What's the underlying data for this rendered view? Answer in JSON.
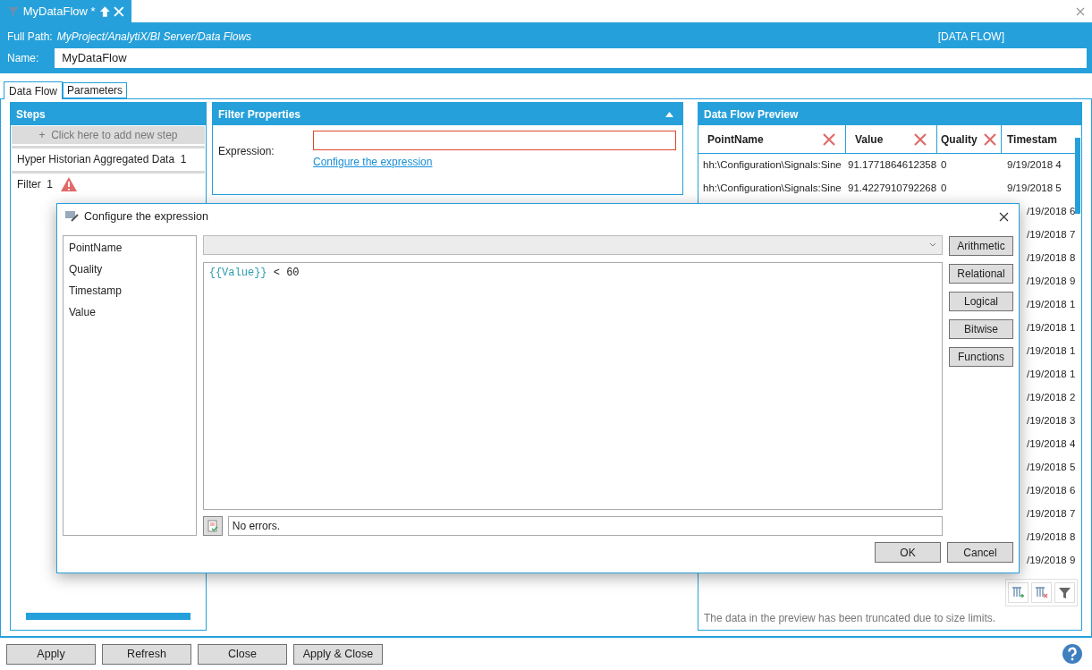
{
  "document_tab": {
    "title": "MyDataFlow *"
  },
  "header": {
    "full_path_label": "Full Path:",
    "full_path": "MyProject/AnalytiX/BI Server/Data Flows",
    "type": "[DATA FLOW]",
    "name_label": "Name:",
    "name": "MyDataFlow"
  },
  "tabs": [
    {
      "label": "Data Flow",
      "selected": true
    },
    {
      "label": "Parameters",
      "selected": false
    }
  ],
  "steps": {
    "title": "Steps",
    "add": "+  Click here to add new step",
    "items": [
      {
        "label": "Hyper Historian Aggregated Data  1",
        "warning": false
      },
      {
        "label": "Filter  1",
        "warning": true
      }
    ]
  },
  "filter_properties": {
    "title": "Filter Properties",
    "expression_label": "Expression:",
    "invalid": true,
    "link": "Configure the expression"
  },
  "preview": {
    "title": "Data Flow Preview",
    "columns": [
      "PointName",
      "Value",
      "Quality",
      "Timestam"
    ],
    "rows": [
      {
        "point": "hh:\\Configuration\\Signals:Sine",
        "value": "91.1771864612358",
        "quality": "0",
        "timestamp": "9/19/2018 4"
      },
      {
        "point": "hh:\\Configuration\\Signals:Sine",
        "value": "91.4227910792268",
        "quality": "0",
        "timestamp": "9/19/2018 5"
      },
      {
        "timestamp": "/19/2018 6"
      },
      {
        "timestamp": "/19/2018 7"
      },
      {
        "timestamp": "/19/2018 8"
      },
      {
        "timestamp": "/19/2018 9"
      },
      {
        "timestamp": "/19/2018 1"
      },
      {
        "timestamp": "/19/2018 1"
      },
      {
        "timestamp": "/19/2018 1"
      },
      {
        "timestamp": "/19/2018 1"
      },
      {
        "timestamp": "/19/2018 2"
      },
      {
        "timestamp": "/19/2018 3"
      },
      {
        "timestamp": "/19/2018 4"
      },
      {
        "timestamp": "/19/2018 5"
      },
      {
        "timestamp": "/19/2018 6"
      },
      {
        "timestamp": "/19/2018 7"
      },
      {
        "timestamp": "/19/2018 8"
      },
      {
        "timestamp": "/19/2018 9"
      }
    ],
    "note": "The data in the preview has been truncated due to size limits."
  },
  "dialog": {
    "title": "Configure the expression",
    "fields": [
      "PointName",
      "Quality",
      "Timestamp",
      "Value"
    ],
    "expression": [
      {
        "text": "{{Value}}",
        "kind": "field"
      },
      {
        "text": " < 60",
        "kind": "plain"
      }
    ],
    "operators": [
      "Arithmetic",
      "Relational",
      "Logical",
      "Bitwise",
      "Functions"
    ],
    "status": "No errors.",
    "ok": "OK",
    "cancel": "Cancel"
  },
  "footer": {
    "buttons": [
      "Apply",
      "Refresh",
      "Close",
      "Apply & Close"
    ]
  }
}
